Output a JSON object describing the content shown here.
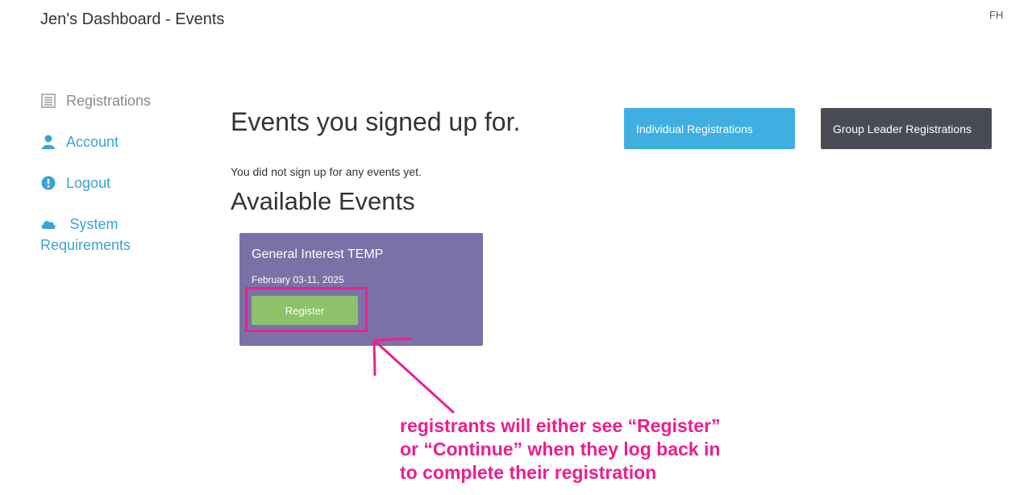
{
  "header": {
    "title": "Jen's Dashboard - Events",
    "user_initials": "FH"
  },
  "sidebar": {
    "items": [
      {
        "label": "Registrations",
        "icon": "list-icon",
        "active": true
      },
      {
        "label": "Account",
        "icon": "user-icon",
        "active": false
      },
      {
        "label": "Logout",
        "icon": "alert-circle-icon",
        "active": false
      },
      {
        "label": "System Requirements",
        "icon": "cloud-icon",
        "active": false
      }
    ]
  },
  "main": {
    "heading": "Events you signed up for.",
    "individual_button": "Individual Registrations",
    "group_button": "Group Leader Registrations",
    "empty_message": "You did not sign up for any events yet.",
    "available_heading": "Available Events",
    "event": {
      "title": "General Interest TEMP",
      "date": "February 03-11, 2025",
      "register_label": "Register"
    }
  },
  "annotation": {
    "line1": "registrants will either see “Register”",
    "line2": "or “Continue” when they log back in",
    "line3": "to complete their registration"
  },
  "colors": {
    "accent_blue": "#3eafe0",
    "dark_button": "#4a4c55",
    "event_card": "#7a72a6",
    "register_green": "#8dc26b",
    "annotation_pink": "#ee1e8c",
    "link_blue": "#3aa3d4"
  }
}
